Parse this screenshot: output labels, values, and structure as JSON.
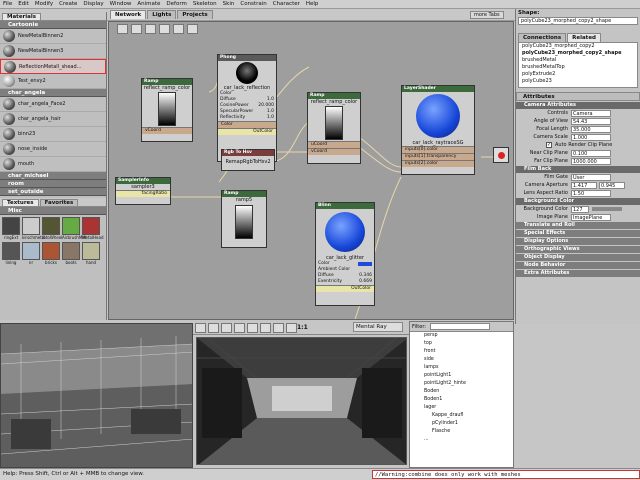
{
  "menu": [
    "File",
    "Edit",
    "Modify",
    "Create",
    "Display",
    "Window",
    "Animate",
    "Deform",
    "Skeleton",
    "Skin",
    "Constrain",
    "Character",
    "Help"
  ],
  "left_panel": {
    "tab": "Materials",
    "groups": [
      {
        "name": "Cartoonie",
        "items": [
          "NewMetalBinnen2",
          "NewMetalBinnen3",
          "ReflectionMetall_shead...",
          "Test_envy2"
        ]
      },
      {
        "name": "char_angela",
        "items": [
          "char_angela_Face2",
          "char_angela_hair",
          "binn23",
          "nose_inside",
          "mouth"
        ]
      },
      {
        "name": "char_michael",
        "items": []
      },
      {
        "name": "room",
        "items": []
      },
      {
        "name": "set_outside",
        "items": []
      }
    ],
    "texture_tabs": [
      "Textures",
      "Favorites"
    ],
    "texture_group": "Misc",
    "texture_labels": [
      "ringExt",
      "kirschmetal",
      "fotoWheel",
      "AirbrushMet",
      "MetalHead",
      "lining",
      "nr",
      "bricks",
      "boots",
      "hand"
    ]
  },
  "network": {
    "tabs": [
      "Network",
      "Lights",
      "Projects"
    ],
    "more_tabs": "more Tabs",
    "nodes": {
      "ramp1": {
        "type": "Ramp",
        "name": "reflect_ramp_color",
        "ports": [
          "vCoord"
        ]
      },
      "phong": {
        "type": "Phong",
        "name": "car_lack_reflection",
        "attrs": [
          [
            "Color",
            ""
          ],
          [
            "Diffuse",
            "1.0"
          ],
          [
            "CosinePower",
            "20.000"
          ],
          [
            "SpecularPower",
            "1.0"
          ],
          [
            "Reflectivity",
            "1.0"
          ]
        ],
        "ports": [
          "Color"
        ],
        "out": "OutColor"
      },
      "rgbtohsv": {
        "type": "Rgb To Hsv",
        "name": "RemapRgbToHsv2"
      },
      "ramp2": {
        "type": "Ramp",
        "name": "reflect_ramp_color",
        "ports": [
          "uCoord",
          "vCoord"
        ]
      },
      "layershader": {
        "type": "LayerShader",
        "name": "car_lack_raytraceSG",
        "ports": [
          "inputs[0].color",
          "inputs[1].transparency",
          "inputs[2].color"
        ]
      },
      "sampler": {
        "type": "SamplerInfo",
        "name": "sampler3",
        "ports": [
          "facingRatio"
        ]
      },
      "ramp3": {
        "type": "Ramp",
        "name": "ramp5"
      },
      "blinn": {
        "type": "Blinn",
        "name": "car_lack_glitter",
        "attrs": [
          [
            "Color",
            ""
          ],
          [
            "Ambient Color",
            ""
          ],
          [
            "Diffuse",
            "0.346"
          ],
          [
            "Exentricity",
            "0.669"
          ]
        ],
        "out": "OutColor"
      }
    }
  },
  "right_panel": {
    "shape_label": "Shape:",
    "shape_value": "polyCube23_morphed_copy2_shape",
    "tabs": [
      "Connections",
      "Related"
    ],
    "related": [
      "polyCube23_morphed_copy2",
      "polyCube23_morphed_copy2_shape",
      "brushedMetal",
      "brushedMetalTop",
      "polyExtrude2",
      "polyCube23"
    ],
    "attributes_title": "Attributes",
    "sections": {
      "camera": "Camera Attributes",
      "controls": [
        "Controls",
        "Camera"
      ],
      "angle": [
        "Angle of View",
        "54.43"
      ],
      "focal": [
        "Focal Length",
        "35.000"
      ],
      "scale": [
        "Camera Scale",
        "1.000"
      ],
      "auto": "Auto Render Clip Plane",
      "near": [
        "Near Clip Plane",
        "0.100"
      ],
      "far": [
        "Far Clip Plane",
        "1000.000"
      ],
      "filmback": "Film Back",
      "filmgate": [
        "Film Gate",
        "User"
      ],
      "aperture": [
        "Camera Aperture",
        "1.417",
        "0.945"
      ],
      "aspect": [
        "Lens Aspect Ratio",
        "1.50"
      ],
      "bg": "Background Color",
      "bgcolor": [
        "Background Color",
        "127"
      ],
      "imageplane": [
        "Image Plane",
        "ImagePlane"
      ],
      "closed": [
        "Translate and Roll",
        "Special Effects",
        "Display Options",
        "Orthographic Views",
        "Object Display",
        "Node Behavior",
        "Extra Attributes"
      ]
    }
  },
  "viewport": {
    "renderer": "Mental Ray",
    "zoom": "1:1"
  },
  "outliner": {
    "filter_label": "Filter:",
    "items": [
      "persp",
      "top",
      "front",
      "side",
      "lamps",
      "pointLight1",
      "pointLight2_hinte",
      "Boden",
      "Boden1",
      "lager",
      "Kappe_draufl",
      "pCylinder1",
      "Flasche",
      "..."
    ],
    "sub_items": [
      "Kappe_draufl",
      "pCylinder1",
      "Flasche"
    ]
  },
  "help_line": "Help: Press Shift, Ctrl or Alt + MMB to change view.",
  "warning": "//Warning:combine does only work with meshes"
}
